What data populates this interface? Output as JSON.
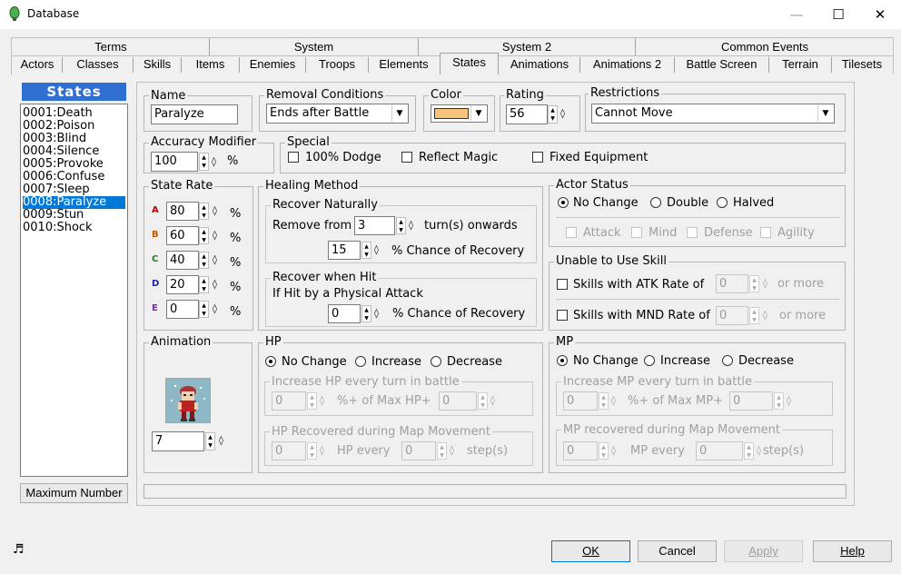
{
  "window": {
    "title": "Database",
    "minimize": "—",
    "maximize": "☐",
    "close": "✕"
  },
  "tabs_row1": [
    "Terms",
    "System",
    "System 2",
    "Common Events"
  ],
  "tabs_row2": [
    "Actors",
    "Classes",
    "Skills",
    "Items",
    "Enemies",
    "Troops",
    "Elements",
    "States",
    "Animations",
    "Animations 2",
    "Battle Screen",
    "Terrain",
    "Tilesets"
  ],
  "active_tab": "States",
  "list": {
    "header": "States",
    "items": [
      "0001:Death",
      "0002:Poison",
      "0003:Blind",
      "0004:Silence",
      "0005:Provoke",
      "0006:Confuse",
      "0007:Sleep",
      "0008:Paralyze",
      "0009:Stun",
      "0010:Shock"
    ],
    "selected_index": 7,
    "max_button": "Maximum Number"
  },
  "name": {
    "label": "Name",
    "value": "Paralyze"
  },
  "removal": {
    "label": "Removal Conditions",
    "value": "Ends after Battle"
  },
  "color": {
    "label": "Color",
    "swatch": "#f8c47c"
  },
  "rating": {
    "label": "Rating",
    "value": "56"
  },
  "restrictions": {
    "label": "Restrictions",
    "value": "Cannot Move"
  },
  "accuracy": {
    "label": "Accuracy Modifier",
    "value": "100",
    "unit": "%"
  },
  "special": {
    "label": "Special",
    "dodge": "100% Dodge",
    "reflect": "Reflect Magic",
    "fixed": "Fixed Equipment"
  },
  "state_rate": {
    "label": "State Rate",
    "letters": [
      "A",
      "B",
      "C",
      "D",
      "E"
    ],
    "letter_colors": [
      "#c00000",
      "#b85c00",
      "#208020",
      "#2020a0",
      "#7030a0"
    ],
    "values": [
      "80",
      "60",
      "40",
      "20",
      "0"
    ],
    "unit": "%"
  },
  "healing": {
    "label": "Healing Method",
    "recover_naturally": "Recover Naturally",
    "remove_from": "Remove from",
    "turns_value": "3",
    "turns_suffix": "turn(s) onwards",
    "chance_value": "15",
    "chance_suffix": "% Chance of Recovery",
    "recover_hit": "Recover when Hit",
    "if_hit": "If Hit by a Physical Attack",
    "hit_chance_value": "0",
    "hit_chance_suffix": "% Chance of Recovery"
  },
  "actor_status": {
    "label": "Actor Status",
    "no_change": "No Change",
    "double": "Double",
    "halved": "Halved",
    "attack": "Attack",
    "mind": "Mind",
    "defense": "Defense",
    "agility": "Agility"
  },
  "unable_skill": {
    "label": "Unable to Use Skill",
    "atk": "Skills with ATK Rate of",
    "mnd": "Skills with MND Rate of",
    "atk_value": "0",
    "mnd_value": "0",
    "or_more": "or more"
  },
  "animation": {
    "label": "Animation",
    "value": "7"
  },
  "hp": {
    "label": "HP",
    "no_change": "No Change",
    "increase": "Increase",
    "decrease": "Decrease",
    "inc_label": "Increase HP every turn in battle",
    "v1": "0",
    "mid": "%+ of Max HP+",
    "v2": "0",
    "rec_label": "HP Recovered during Map Movement",
    "v3": "0",
    "every": "HP every",
    "v4": "0",
    "steps": "step(s)"
  },
  "mp": {
    "label": "MP",
    "no_change": "No Change",
    "increase": "Increase",
    "decrease": "Decrease",
    "inc_label": "Increase MP every turn in battle",
    "v1": "0",
    "mid": "%+ of Max MP+",
    "v2": "0",
    "rec_label": "MP recovered during Map Movement",
    "v3": "0",
    "every": "MP every",
    "v4": "0",
    "steps": "step(s)"
  },
  "buttons": {
    "ok": "OK",
    "cancel": "Cancel",
    "apply": "Apply",
    "help": "Help"
  }
}
